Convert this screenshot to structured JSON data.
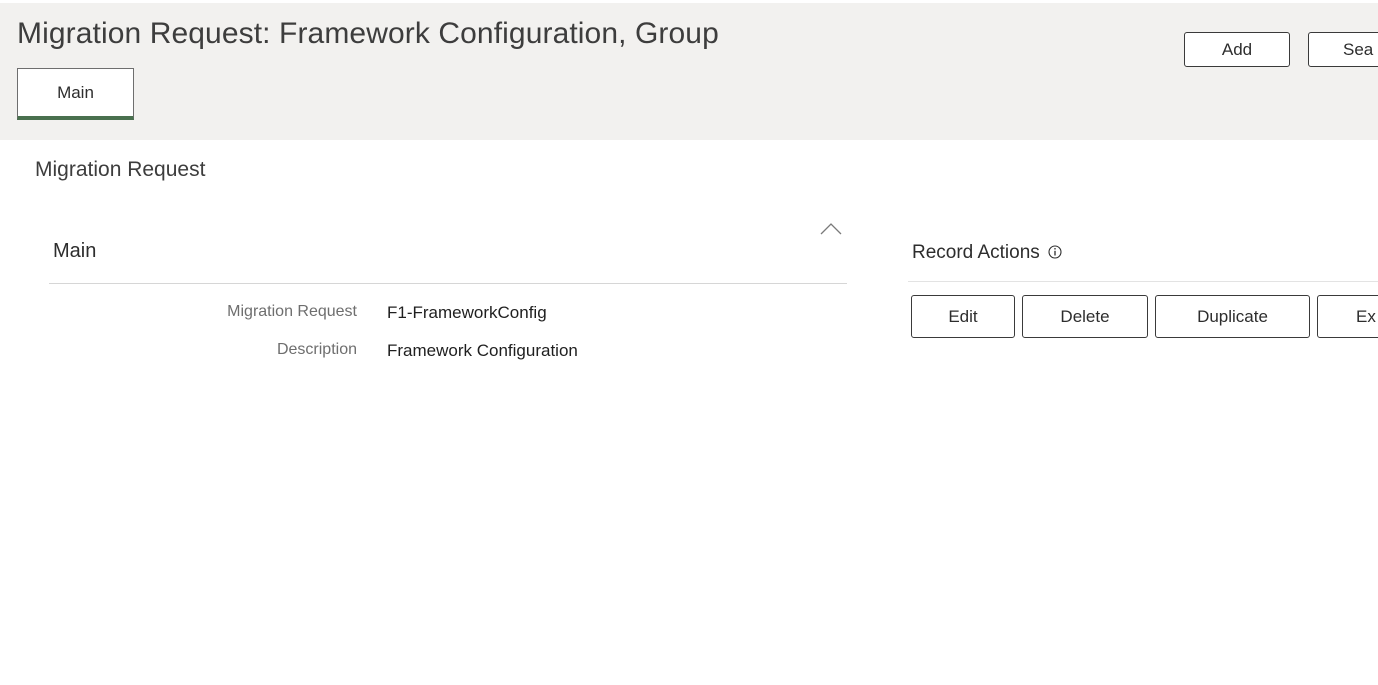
{
  "header": {
    "title": "Migration Request: Framework Configuration, Group",
    "add_label": "Add",
    "search_label": "Sea",
    "tab_main_label": "Main"
  },
  "section": {
    "title": "Migration Request"
  },
  "main_panel": {
    "title": "Main",
    "collapse_icon": "chevron-up-icon",
    "fields": [
      {
        "label": "Migration Request",
        "value": "F1-FrameworkConfig"
      },
      {
        "label": "Description",
        "value": "Framework Configuration"
      }
    ]
  },
  "record_actions": {
    "title": "Record Actions",
    "info_icon": "info-icon",
    "buttons": {
      "edit": "Edit",
      "delete": "Delete",
      "duplicate": "Duplicate",
      "export": "Ex"
    }
  },
  "colors": {
    "header_bg": "#f2f1ef",
    "tab_accent": "#49704e",
    "button_border": "#3a3a3a"
  }
}
